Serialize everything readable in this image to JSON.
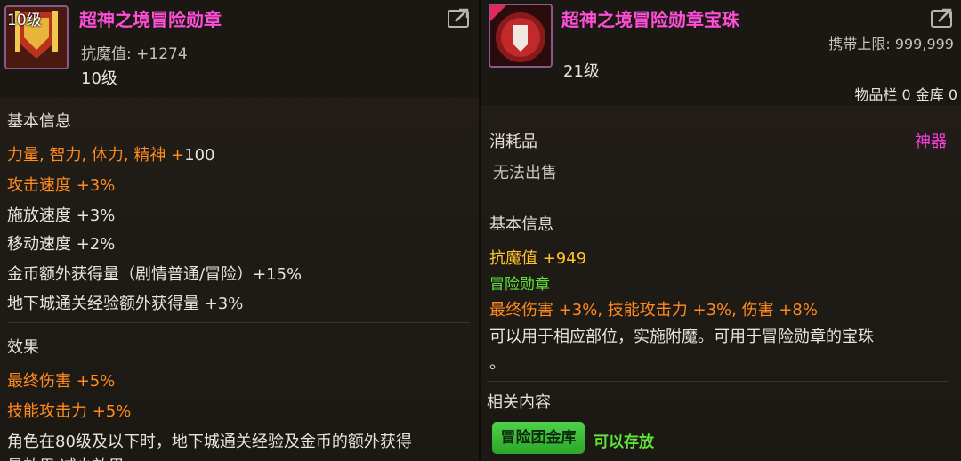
{
  "left": {
    "level_badge": "10级",
    "title": "超神之境冒险勋章",
    "resist_label": "抗魔值: +1274",
    "level": "10级",
    "section_basic": "基本信息",
    "basic_lines": [
      {
        "label": "力量, 智力, 体力, 精神 +",
        "value": "100"
      },
      {
        "label": "攻击速度 +3%"
      },
      {
        "label": "施放速度 +3%"
      },
      {
        "label": "移动速度 +2%"
      },
      {
        "label": "金币额外获得量（剧情普通/冒险）+15%"
      },
      {
        "label": "地下城通关经验额外获得量 +3%"
      }
    ],
    "section_effect": "效果",
    "effect_lines": [
      "最终伤害 +5%",
      "技能攻击力 +5%",
      "角色在80级及以下时，地下城通关经验及金币的额外获得",
      "量效果 减少效果"
    ]
  },
  "right": {
    "title": "超神之境冒险勋章宝珠",
    "carry_limit": "携带上限: 999,999",
    "level": "21级",
    "inventory": "物品栏 0 金库 0",
    "category": "消耗品",
    "rarity": "神器",
    "unsellable": "无法出售",
    "section_basic": "基本信息",
    "resist": "抗魔值 +949",
    "medal_label": "冒险勋章",
    "stats": "最终伤害 +3%, 技能攻击力 +3%, 伤害 +8%",
    "desc1": "可以用于相应部位，实施附魔。可用于冒险勋章的宝珠",
    "desc2": "。",
    "section_related": "相关内容",
    "vault_button": "冒险团金库",
    "storable": "可以存放"
  },
  "colors": {
    "title": "#ff4fd8",
    "orange": "#ff8a1e",
    "yellow": "#ffc42a",
    "green": "#5ee33a",
    "rarity": "#ff3fe0"
  },
  "icons": [
    "medal-icon",
    "orb-icon",
    "share-icon"
  ]
}
